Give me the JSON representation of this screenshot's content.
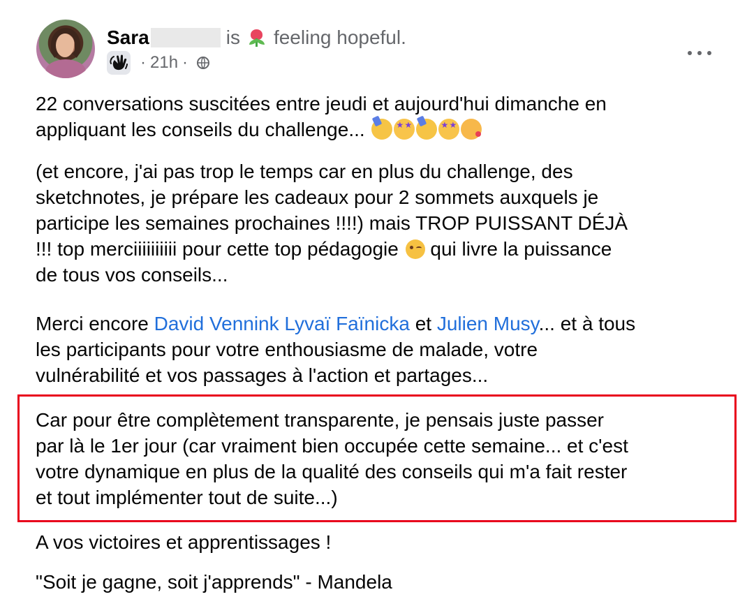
{
  "post": {
    "author": {
      "name": "Sara",
      "activity_prefix": "is",
      "feeling": "feeling hopeful.",
      "time": "21h",
      "separator": "·"
    },
    "icons": {
      "avatar": "profile-photo",
      "feeling": "tulip-icon",
      "badge": "waving-hand-icon",
      "audience": "globe-icon",
      "menu": "more-options-icon",
      "emoji_sequence": [
        "party-face-icon",
        "star-struck-face-icon",
        "party-face-icon",
        "star-struck-face-icon",
        "kissing-face-icon"
      ],
      "wink": "winking-face-icon"
    },
    "body": {
      "p1": [
        "22 conversations suscitées entre jeudi et aujourd'hui dimanche en",
        "appliquant les conseils du challenge..."
      ],
      "p2": [
        "(et encore, j'ai pas trop le temps car en plus du challenge, des",
        "sketchnotes, je prépare les cadeaux pour 2 sommets auxquels je",
        "participe les semaines prochaines !!!!) mais TROP PUISSANT DÉJÀ",
        "!!! top merciiiiiiiiii pour cette top pédagogie",
        "qui livre la puissance",
        "de tous vos conseils..."
      ],
      "p3": {
        "line1_prefix": "Merci encore",
        "mention1": "David Vennink Lyvaï Faïnicka",
        "line1_middle": "et",
        "mention2": "Julien Musy",
        "line1_suffix": "... et à tous",
        "line2": "les participants pour votre enthousiasme de malade, votre",
        "line3": "vulnérabilité et vos passages à l'action et partages..."
      },
      "p4": [
        "Car pour être complètement transparente, je pensais juste passer",
        "par là le 1er jour (car vraiment bien occupée cette semaine... et c'est",
        "votre dynamique en plus de la qualité des conseils qui m'a fait rester",
        "et tout implémenter tout de suite...)"
      ],
      "p5": "A vos victoires et apprentissages !",
      "p6": "\"Soit je gagne, soit j'apprends\" - Mandela"
    },
    "colors": {
      "mention": "#216fdb",
      "highlight_border": "#e8001c",
      "secondary_text": "#65676b"
    }
  }
}
